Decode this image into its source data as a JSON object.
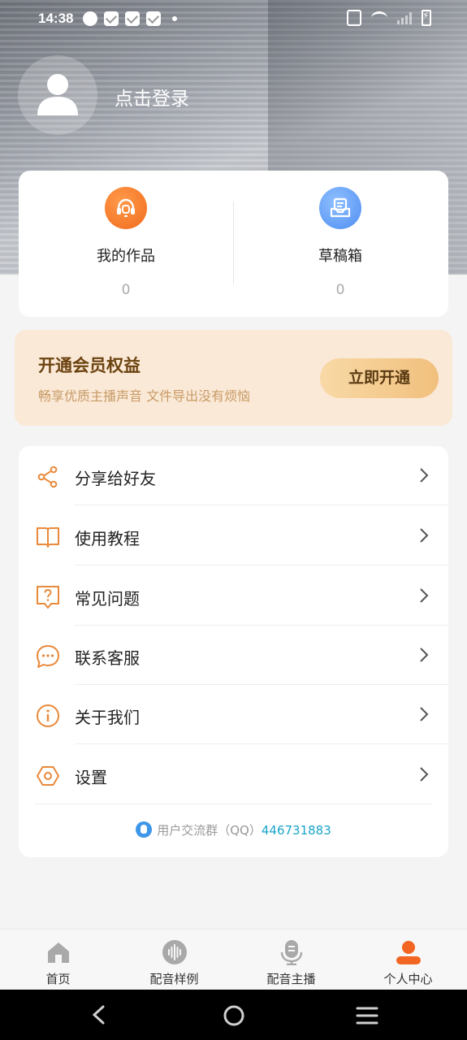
{
  "status_bar": {
    "time": "14:38",
    "accent": "#ffffff"
  },
  "profile": {
    "login_label": "点击登录",
    "avatar_icon": "user-icon"
  },
  "works": {
    "items": [
      {
        "label": "我的作品",
        "count": "0",
        "icon": "headset-icon",
        "color": "#f27a2a"
      },
      {
        "label": "草稿箱",
        "count": "0",
        "icon": "draft-box-icon",
        "color": "#5b95f0"
      }
    ]
  },
  "vip": {
    "title": "开通会员权益",
    "subtitle": "畅享优质主播声音 文件导出没有烦恼",
    "button": "立即开通"
  },
  "menu": {
    "items": [
      {
        "label": "分享给好友",
        "icon": "share-icon"
      },
      {
        "label": "使用教程",
        "icon": "book-icon"
      },
      {
        "label": "常见问题",
        "icon": "question-icon"
      },
      {
        "label": "联系客服",
        "icon": "chat-icon"
      },
      {
        "label": "关于我们",
        "icon": "info-icon"
      },
      {
        "label": "设置",
        "icon": "settings-icon"
      }
    ],
    "qq_label": "用户交流群（QQ）",
    "qq_number": "446731883"
  },
  "tabs": {
    "items": [
      {
        "label": "首页",
        "icon": "home-icon",
        "active": false
      },
      {
        "label": "配音样例",
        "icon": "audio-wave-icon",
        "active": false
      },
      {
        "label": "配音主播",
        "icon": "microphone-icon",
        "active": false
      },
      {
        "label": "个人中心",
        "icon": "person-icon",
        "active": true
      }
    ],
    "active_color": "#f26522",
    "inactive_color": "#a9a9a9"
  }
}
